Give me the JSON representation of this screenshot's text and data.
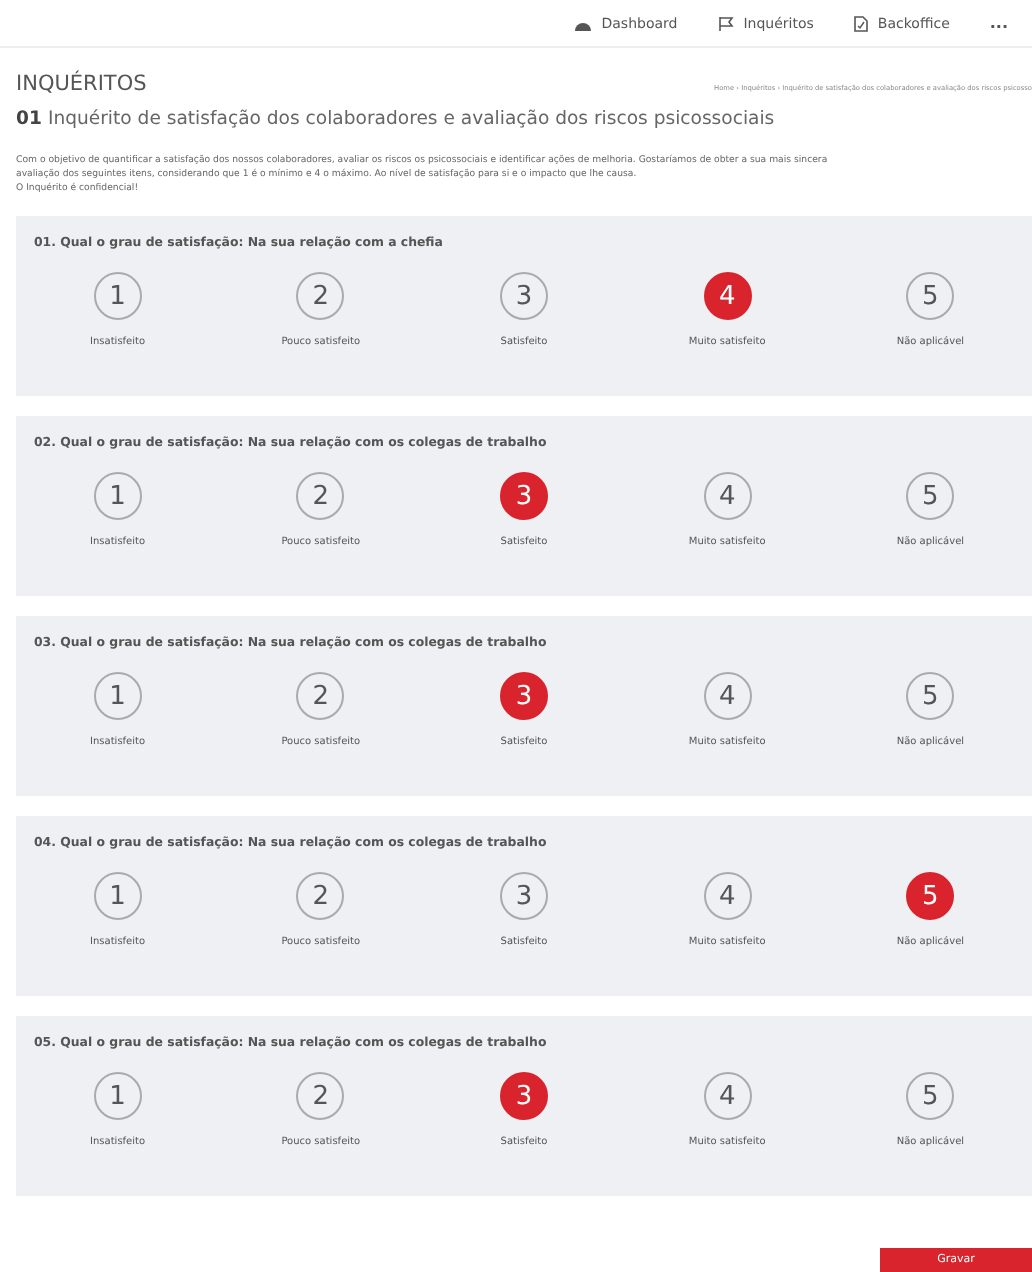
{
  "nav": {
    "items": [
      {
        "label": "Dashboard"
      },
      {
        "label": "Inquéritos"
      },
      {
        "label": "Backoffice"
      }
    ],
    "more": "..."
  },
  "header": {
    "section": "INQUÉRITOS",
    "breadcrumb": "Home › Inquéritos › Inquérito de satisfação dos colaboradores e avaliação dos riscos psicosso",
    "number": "01",
    "title": "Inquérito de satisfação dos colaboradores e avaliação dos riscos psicossociais"
  },
  "intro": [
    "Com o objetivo de quantificar a satisfação dos nossos colaboradores, avaliar os riscos os psicossociais e identificar ações de melhoria. Gostaríamos de obter a sua mais sincera avaliação dos seguintes itens, considerando que 1 é o mínimo e 4 o máximo. Ao nível de satisfação para si e o impacto que lhe causa.",
    "O Inquérito é confidencial!"
  ],
  "questions": [
    {
      "title": "01. Qual o grau de satisfação: Na sua relação com a chefia",
      "options": [
        {
          "value": "1",
          "label": "Insatisfeito",
          "selected": false
        },
        {
          "value": "2",
          "label": "Pouco satisfeito",
          "selected": false
        },
        {
          "value": "3",
          "label": "Satisfeito",
          "selected": false
        },
        {
          "value": "4",
          "label": "Muito satisfeito",
          "selected": true
        },
        {
          "value": "5",
          "label": "Não aplicável",
          "selected": false
        }
      ]
    },
    {
      "title": "02. Qual o grau de satisfação: Na sua relação com os colegas de trabalho",
      "options": [
        {
          "value": "1",
          "label": "Insatisfeito",
          "selected": false
        },
        {
          "value": "2",
          "label": "Pouco satisfeito",
          "selected": false
        },
        {
          "value": "3",
          "label": "Satisfeito",
          "selected": true
        },
        {
          "value": "4",
          "label": "Muito satisfeito",
          "selected": false
        },
        {
          "value": "5",
          "label": "Não aplicável",
          "selected": false
        }
      ]
    },
    {
      "title": "03. Qual o grau de satisfação: Na sua relação com os colegas de trabalho",
      "options": [
        {
          "value": "1",
          "label": "Insatisfeito",
          "selected": false
        },
        {
          "value": "2",
          "label": "Pouco satisfeito",
          "selected": false
        },
        {
          "value": "3",
          "label": "Satisfeito",
          "selected": true
        },
        {
          "value": "4",
          "label": "Muito satisfeito",
          "selected": false
        },
        {
          "value": "5",
          "label": "Não aplicável",
          "selected": false
        }
      ]
    },
    {
      "title": "04. Qual o grau de satisfação: Na sua relação com os colegas de trabalho",
      "options": [
        {
          "value": "1",
          "label": "Insatisfeito",
          "selected": false
        },
        {
          "value": "2",
          "label": "Pouco satisfeito",
          "selected": false
        },
        {
          "value": "3",
          "label": "Satisfeito",
          "selected": false
        },
        {
          "value": "4",
          "label": "Muito satisfeito",
          "selected": false
        },
        {
          "value": "5",
          "label": "Não aplicável",
          "selected": true
        }
      ]
    },
    {
      "title": "05. Qual o grau de satisfação: Na sua relação com os colegas de trabalho",
      "options": [
        {
          "value": "1",
          "label": "Insatisfeito",
          "selected": false
        },
        {
          "value": "2",
          "label": "Pouco satisfeito",
          "selected": false
        },
        {
          "value": "3",
          "label": "Satisfeito",
          "selected": true
        },
        {
          "value": "4",
          "label": "Muito satisfeito",
          "selected": false
        },
        {
          "value": "5",
          "label": "Não aplicável",
          "selected": false
        }
      ]
    }
  ],
  "submit": "Gravar"
}
